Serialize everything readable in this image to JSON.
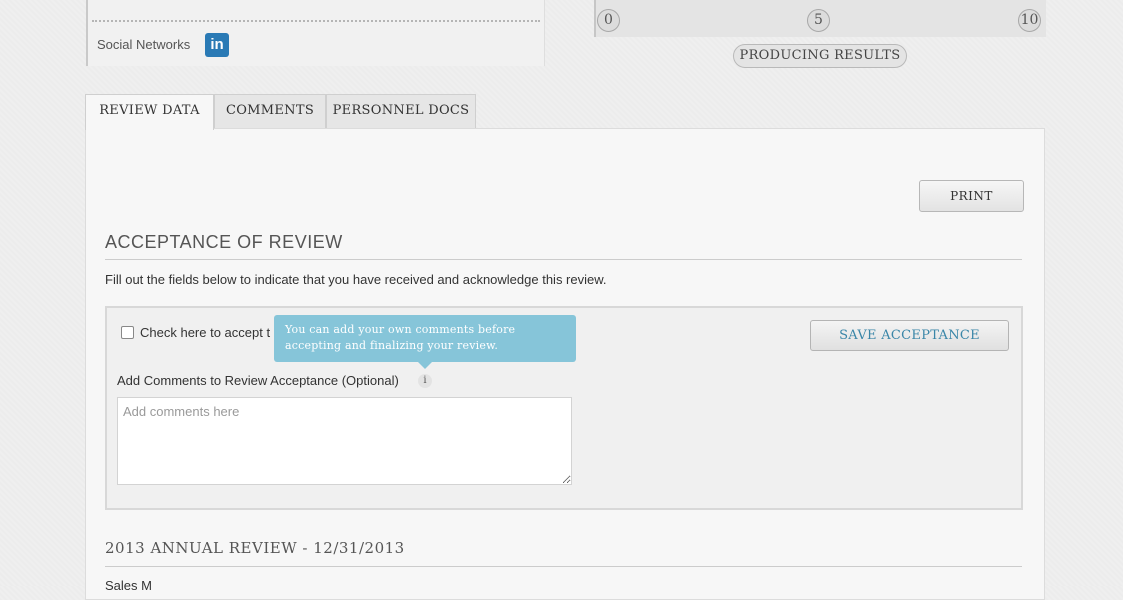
{
  "profile": {
    "social_label": "Social Networks",
    "linkedin_icon": "linkedin-icon",
    "linkedin_text": "in"
  },
  "rating": {
    "scale": [
      "0",
      "5",
      "10"
    ],
    "category": "PRODUCING RESULTS"
  },
  "tabs": [
    {
      "label": "REVIEW DATA",
      "active": true
    },
    {
      "label": "COMMENTS",
      "active": false
    },
    {
      "label": "PERSONNEL DOCS",
      "active": false
    }
  ],
  "toolbar": {
    "print_label": "PRINT"
  },
  "acceptance": {
    "title": "ACCEPTANCE OF REVIEW",
    "instructions": "Fill out the fields below to indicate that you have received and acknowledge this review.",
    "checkbox_label": "Check here to accept t",
    "save_label": "SAVE ACCEPTANCE",
    "tooltip": "You can add your own comments before accepting and finalizing your review.",
    "comments_label": "Add Comments to Review Acceptance (Optional)",
    "info_glyph": "i",
    "comments_value": "",
    "comments_placeholder": "Add comments here"
  },
  "annual_review": {
    "title": "2013 ANNUAL REVIEW - 12/31/2013",
    "cutoff_text": "Sales M"
  },
  "colors": {
    "accent_blue": "#3a86a8",
    "tooltip_bg": "#86c5d9",
    "linkedin": "#2a7ab5"
  }
}
